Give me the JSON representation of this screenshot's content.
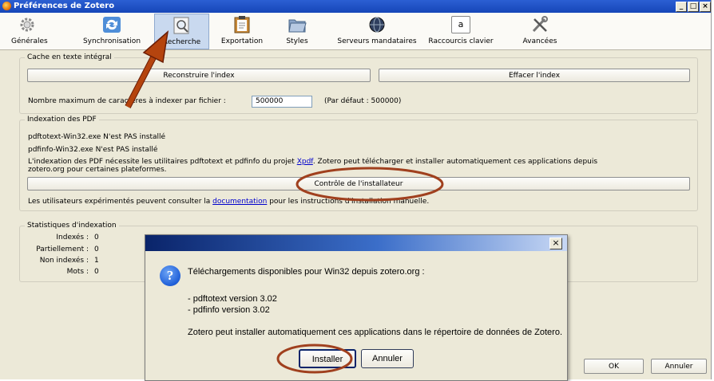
{
  "window": {
    "title": "Préférences de Zotero",
    "controls": {
      "minimize": "_",
      "maximize": "□",
      "close": "×"
    }
  },
  "tabs": [
    {
      "label": "Générales",
      "icon": "gear-icon"
    },
    {
      "label": "Synchronisation",
      "icon": "sync-icon"
    },
    {
      "label": "Recherche",
      "icon": "search-icon",
      "active": true
    },
    {
      "label": "Exportation",
      "icon": "clipboard-icon"
    },
    {
      "label": "Styles",
      "icon": "folder-icon"
    },
    {
      "label": "Serveurs mandataires",
      "icon": "globe-icon"
    },
    {
      "label": "Raccourcis clavier",
      "icon": "keyboard-key-icon",
      "key_glyph": "a"
    },
    {
      "label": "Avancées",
      "icon": "tools-icon"
    }
  ],
  "fulltext": {
    "legend": "Cache en texte intégral",
    "rebuild_label": "Reconstruire l'index",
    "clear_label": "Effacer l'index",
    "max_chars_label": "Nombre maximum de caractères à indexer par fichier :",
    "max_chars_value": "500000",
    "default_note": "(Par défaut : 500000)"
  },
  "pdf": {
    "legend": "Indexation des PDF",
    "pdftotext_status": "pdftotext-Win32.exe N'est PAS installé",
    "pdfinfo_status": "pdfinfo-Win32.exe N'est PAS installé",
    "desc_before": "L'indexation des PDF nécessite les utilitaires pdftotext et pdfinfo du projet ",
    "desc_link": "Xpdf",
    "desc_after": ". Zotero peut télécharger et installer automatiquement ces applications depuis",
    "desc_line2": "zotero.org pour certaines plateformes.",
    "installer_check_label": "Contrôle de l'installateur",
    "advanced_before": "Les utilisateurs expérimentés peuvent consulter la ",
    "advanced_link": "documentation",
    "advanced_after": " pour les instructions d'installation manuelle."
  },
  "stats": {
    "legend": "Statistiques d'indexation",
    "rows": [
      {
        "label": "Indexés :",
        "value": "0"
      },
      {
        "label": "Partiellement :",
        "value": "0"
      },
      {
        "label": "Non indexés :",
        "value": "1"
      },
      {
        "label": "Mots :",
        "value": "0"
      }
    ]
  },
  "dialog": {
    "close": "×",
    "icon": "question-icon",
    "icon_glyph": "?",
    "line1": "Téléchargements disponibles pour Win32 depuis zotero.org :",
    "item1": "- pdftotext version 3.02",
    "item2": "- pdfinfo version 3.02",
    "line3": "Zotero peut installer automatiquement ces applications dans le répertoire de données de Zotero.",
    "install_label": "Installer",
    "cancel_label": "Annuler"
  },
  "footer": {
    "ok_label": "OK",
    "cancel_label": "Annuler"
  },
  "annotations": {
    "arrow_color": "#b5440e",
    "circle_color": "#a0401e"
  }
}
